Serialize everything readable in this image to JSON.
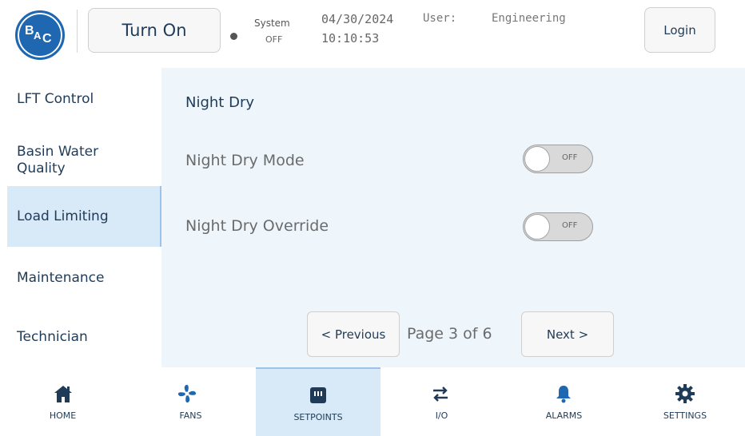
{
  "header": {
    "logo_text": "BAC",
    "power_button_label": "Turn On",
    "system_label": "System",
    "system_state": "OFF",
    "date": "04/30/2024",
    "time": "10:10:53",
    "user_label": "User:",
    "user_name": "Engineering",
    "login_label": "Login"
  },
  "sidebar": {
    "items": [
      {
        "label": "LFT Control"
      },
      {
        "label": "Basin Water Quality"
      },
      {
        "label": "Load Limiting",
        "active": true
      },
      {
        "label": "Maintenance"
      },
      {
        "label": "Technician"
      }
    ]
  },
  "main": {
    "title": "Night Dry",
    "rows": [
      {
        "label": "Night Dry Mode",
        "toggle_state": "OFF"
      },
      {
        "label": "Night Dry Override",
        "toggle_state": "OFF"
      }
    ],
    "pager": {
      "previous_label": "< Previous",
      "page_text": "Page 3 of 6",
      "next_label": "Next >"
    }
  },
  "nav": {
    "items": [
      {
        "label": "HOME",
        "icon": "home-icon"
      },
      {
        "label": "FANS",
        "icon": "fan-icon"
      },
      {
        "label": "SETPOINTS",
        "icon": "setpoints-icon",
        "active": true
      },
      {
        "label": "I/O",
        "icon": "io-arrows-icon"
      },
      {
        "label": "ALARMS",
        "icon": "bell-icon"
      },
      {
        "label": "SETTINGS",
        "icon": "gear-icon"
      }
    ]
  },
  "colors": {
    "brand_blue": "#1f67b1",
    "text_navy": "#1f3b57",
    "panel_bg": "#eef6fc",
    "active_bg": "#d8e9f8"
  }
}
